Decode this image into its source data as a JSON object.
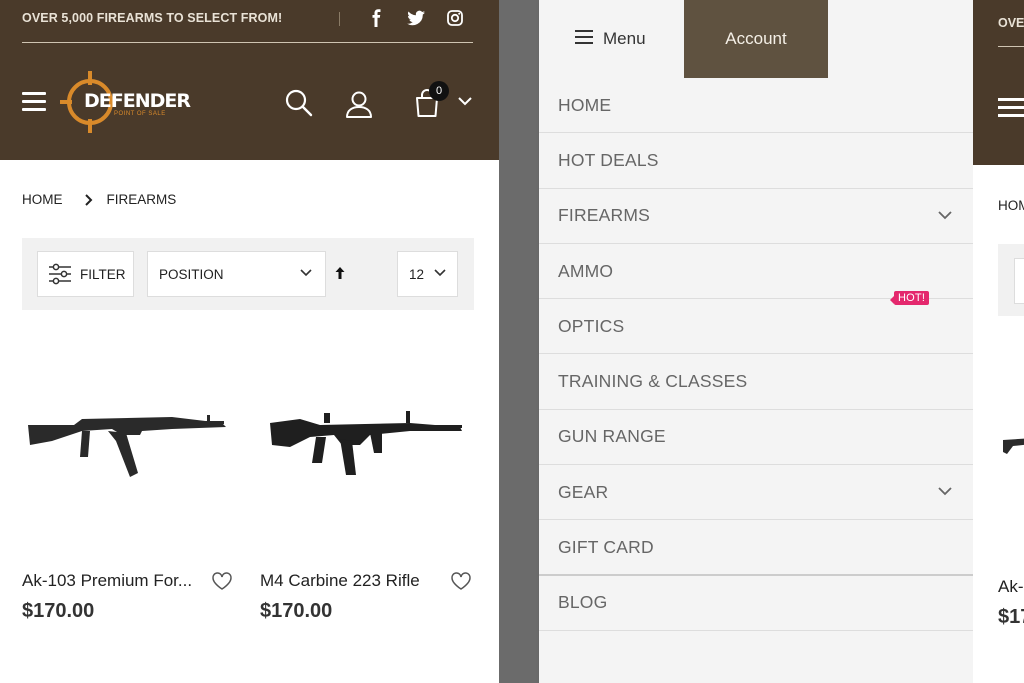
{
  "left_panel": {
    "topbar": {
      "promo_text": "OVER 5,000 FIREARMS TO SELECT FROM!",
      "social": [
        "facebook-icon",
        "twitter-icon",
        "instagram-icon"
      ]
    },
    "header": {
      "logo_text": "DEFENDER",
      "logo_subtext": "POINT OF SALE",
      "cart_count": "0"
    },
    "breadcrumb": {
      "home": "HOME",
      "current": "FIREARMS"
    },
    "toolbar": {
      "filter_label": "FILTER",
      "sort_by": "POSITION",
      "limit": "12"
    },
    "products": [
      {
        "name": "Ak-103 Premium For...",
        "price": "$170.00"
      },
      {
        "name": "M4 Carbine 223 Rifle",
        "price": "$170.00"
      }
    ]
  },
  "menu_panel": {
    "tabs": {
      "menu_label": "Menu",
      "account_label": "Account"
    },
    "items": [
      {
        "label": "HOME"
      },
      {
        "label": "HOT DEALS"
      },
      {
        "label": "FIREARMS"
      },
      {
        "label": "AMMO"
      },
      {
        "label": "OPTICS"
      },
      {
        "label": "TRAINING & CLASSES"
      },
      {
        "label": "GUN RANGE"
      },
      {
        "label": "GEAR"
      },
      {
        "label": "GIFT CARD"
      },
      {
        "label": "BLOG"
      }
    ],
    "hot_badge": "HOT!"
  },
  "right_panel": {
    "promo_text": "OVE",
    "breadcrumb_text": "HOM",
    "product_name": "Ak-",
    "product_price": "$17"
  },
  "colors": {
    "header_brown": "#4a3a2a",
    "account_tab": "#5f5240",
    "logo_orange": "#d98a2a",
    "hot_badge": "#e4286d"
  }
}
